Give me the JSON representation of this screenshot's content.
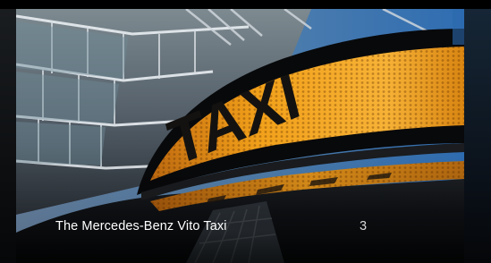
{
  "slide": {
    "title": "The Mercedes-Benz Vito Taxi",
    "index": "3",
    "sign_text": "TAXI",
    "image_alt": "taxi-sign-photo"
  },
  "colors": {
    "sign_amber": "#f2a11a",
    "sky": "#3e79b3",
    "roof": "#0b0c0e"
  }
}
